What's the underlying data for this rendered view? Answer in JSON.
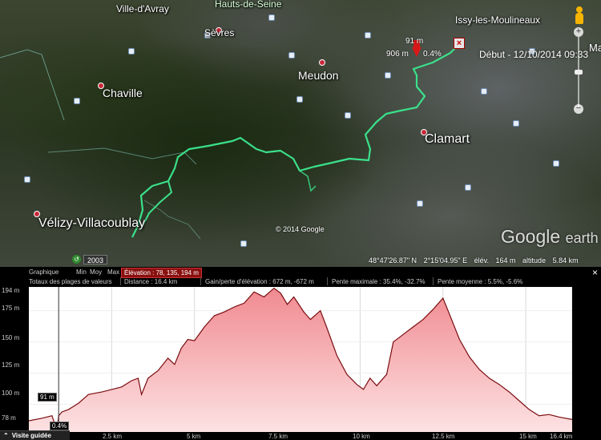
{
  "map": {
    "places": [
      {
        "label": "Ville-d'Avray"
      },
      {
        "label": "Hauts-de-Seine"
      },
      {
        "label": "Sèvres"
      },
      {
        "label": "Issy-les-Moulineaux"
      },
      {
        "label": "Meudon"
      },
      {
        "label": "Chaville"
      },
      {
        "label": "Clamart"
      },
      {
        "label": "Vélizy-Villacoublay"
      }
    ],
    "crop_right_label": "Mala",
    "start_marker": {
      "label": "Début - 12/10/2014 09:33",
      "icon": "x-flag-icon"
    },
    "cursor": {
      "elevation_tag": "91 m",
      "distance_tag": "906 m",
      "slope_tag": "0.4%"
    },
    "copyright": "© 2014 Google",
    "logo": {
      "brand": "Google",
      "product": "earth"
    },
    "coords": {
      "lat": "48°47'26.87\" N",
      "lon": "2°15'04.95\" E",
      "elev_label": "élév.",
      "elev_value": "164 m",
      "alt_label": "altitude",
      "alt_value": "5.84 km"
    },
    "year": "2003",
    "route_color": "#3be08a"
  },
  "elevation_panel": {
    "menu": {
      "graph": "Graphique",
      "min": "Min",
      "avg": "Moy",
      "max": "Max",
      "selected": "Élévation : 78, 135, 194 m"
    },
    "close_icon": "close-icon",
    "stats": {
      "totals": "Totaux des plages de valeurs",
      "distance": "Distance : 16.4 km",
      "gain": "Gain/perte d'élévation : 672 m, -672 m",
      "max_slope": "Pente maximale : 35.4%, -32.7%",
      "avg_slope": "Pente moyenne : 5.5%, -5.6%"
    },
    "cursor_tag_elev": "91 m",
    "cursor_tag_slope": "0.4%",
    "tour_button": "Visite guidée"
  },
  "chart_data": {
    "type": "area",
    "xlabel": "",
    "ylabel": "",
    "x_ticks": [
      "2.5 km",
      "5 km",
      "7.5 km",
      "10 km",
      "12.5 km",
      "15 km",
      "16.4 km"
    ],
    "y_ticks": [
      "194 m",
      "175 m",
      "150 m",
      "125 m",
      "100 m",
      "78 m"
    ],
    "xlim": [
      0,
      16.4
    ],
    "ylim": [
      78,
      194
    ],
    "fill_color": "#f7b6b8",
    "line_color": "#7a0c10",
    "series": [
      {
        "x": [
          0,
          0.4,
          0.7,
          0.85,
          0.9,
          1.0,
          1.2,
          1.5,
          1.8,
          2.2,
          2.5,
          2.8,
          3.1,
          3.3,
          3.4,
          3.6,
          3.9,
          4.2,
          4.4,
          4.6,
          4.8,
          5.0,
          5.3,
          5.6,
          5.9,
          6.2,
          6.5,
          6.8,
          7.1,
          7.4,
          7.6,
          7.8,
          8.0,
          8.3,
          8.5,
          8.8,
          9.0,
          9.3,
          9.6,
          9.9,
          10.1,
          10.3,
          10.5,
          10.8,
          11.0,
          11.3,
          11.6,
          11.9,
          12.2,
          12.5,
          12.7,
          13.0,
          13.3,
          13.6,
          13.9,
          14.2,
          14.5,
          14.8,
          15.1,
          15.4,
          15.7,
          16.0,
          16.4
        ],
        "y": [
          87,
          89,
          91,
          79,
          91,
          94,
          96,
          101,
          108,
          110,
          112,
          114,
          119,
          121,
          108,
          121,
          127,
          137,
          132,
          145,
          152,
          151,
          162,
          171,
          174,
          178,
          181,
          190,
          186,
          193,
          189,
          180,
          186,
          174,
          168,
          175,
          161,
          139,
          124,
          116,
          112,
          121,
          115,
          124,
          150,
          156,
          162,
          168,
          176,
          185,
          172,
          152,
          138,
          128,
          121,
          116,
          110,
          103,
          96,
          91,
          92,
          90,
          88
        ]
      }
    ],
    "grid": true
  }
}
